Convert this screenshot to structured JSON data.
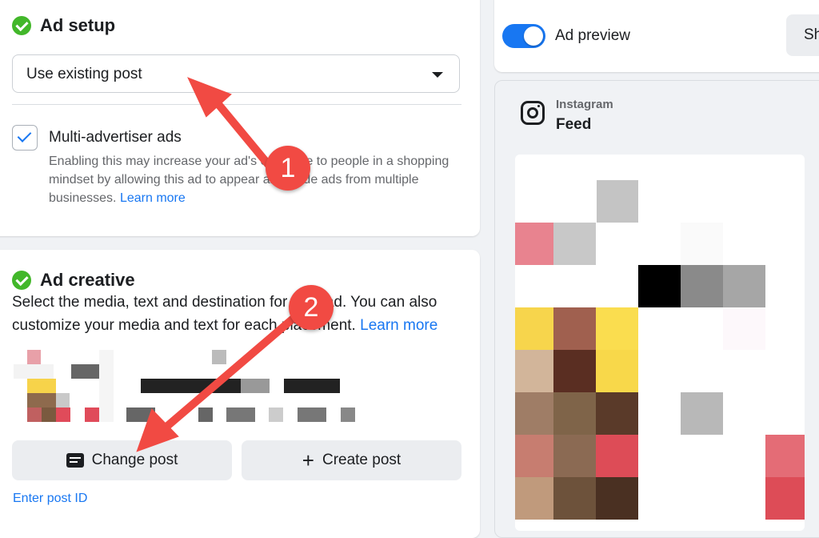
{
  "ad_setup": {
    "title": "Ad setup",
    "post_select_value": "Use existing post",
    "multi_advertiser_label": "Multi-advertiser ads",
    "multi_advertiser_desc": "Enabling this may increase your ad's exposure to people in a shopping mindset by allowing this ad to appear alongside ads from multiple businesses.",
    "learn_more": "Learn more"
  },
  "ad_creative": {
    "title": "Ad creative",
    "description": "Select the media, text and destination for your ad. You can also customize your media and text for each placement.",
    "learn_more": "Learn more",
    "change_post_label": "Change post",
    "create_post_label": "Create post",
    "enter_post_id": "Enter post ID"
  },
  "preview": {
    "toggle_label": "Ad preview",
    "share_label": "Sh",
    "platform": "Instagram",
    "placement": "Feed"
  },
  "annotations": {
    "step1": "1",
    "step2": "2"
  },
  "colors": {
    "accent": "#1877f2",
    "success": "#42b72a",
    "annotation": "#f14a43"
  }
}
